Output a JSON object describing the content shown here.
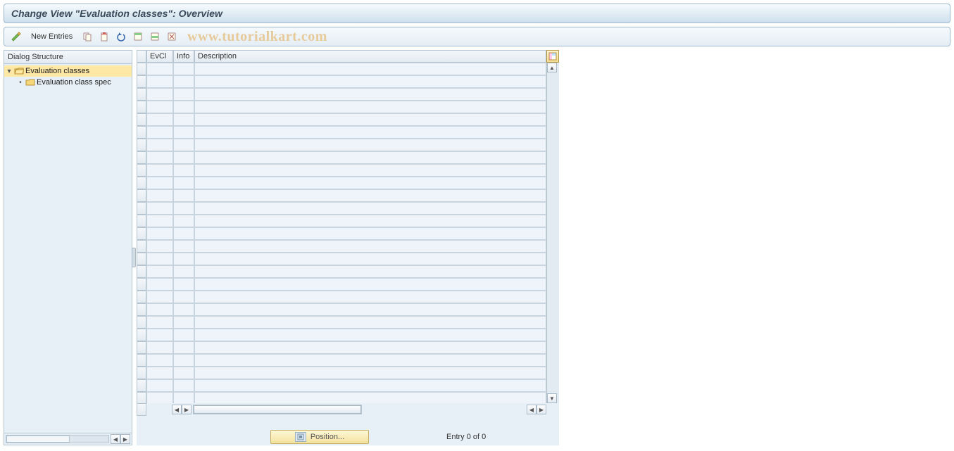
{
  "header": {
    "title": "Change View \"Evaluation classes\": Overview"
  },
  "toolbar": {
    "new_entries": "New Entries"
  },
  "watermark": "www.tutorialkart.com",
  "tree": {
    "header": "Dialog Structure",
    "node1": "Evaluation classes",
    "node2": "Evaluation class spec"
  },
  "table": {
    "columns": {
      "evcl": "EvCl",
      "info": "Info",
      "desc": "Description"
    },
    "row_count": 27
  },
  "footer": {
    "position_label": "Position...",
    "entry_text": "Entry 0 of 0"
  }
}
